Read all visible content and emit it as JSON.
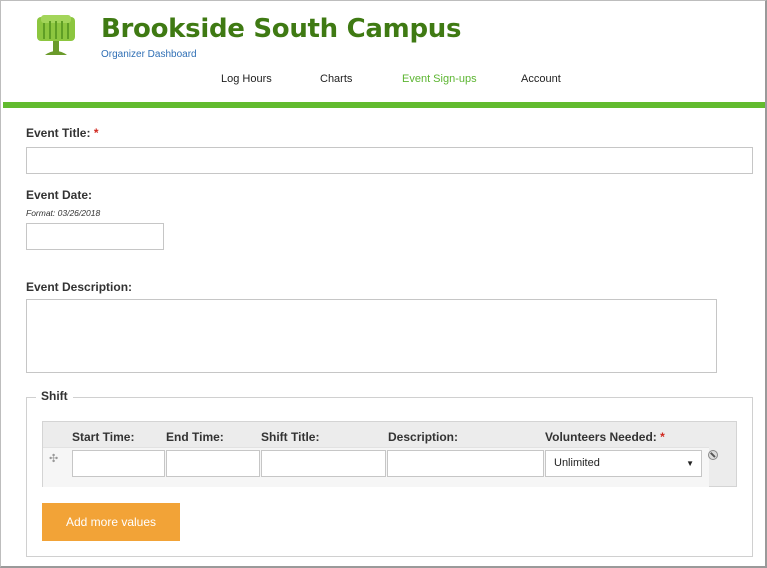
{
  "header": {
    "site_title": "Brookside South Campus",
    "slogan": "Organizer Dashboard",
    "logo_icon": "tree-logo-icon"
  },
  "nav": {
    "items": [
      {
        "label": "Log Hours"
      },
      {
        "label": "Charts"
      },
      {
        "label": "Event Sign-ups",
        "active": true
      },
      {
        "label": "Account"
      }
    ]
  },
  "colors": {
    "brand_green": "#3f7a13",
    "accent_bar": "#62bb2f",
    "button": "#f2a337",
    "required": "#d0281f"
  },
  "form": {
    "event_title": {
      "label": "Event Title:",
      "required_mark": "*",
      "value": ""
    },
    "event_date": {
      "label": "Event Date:",
      "hint": "Format: 03/26/2018",
      "value": ""
    },
    "event_description": {
      "label": "Event Description:",
      "value": ""
    },
    "shift": {
      "legend": "Shift",
      "columns": {
        "start_time": "Start Time:",
        "end_time": "End Time:",
        "shift_title": "Shift Title:",
        "description": "Description:",
        "volunteers_needed": "Volunteers Needed:",
        "required_mark": "*"
      },
      "row": {
        "start_time": "",
        "end_time": "",
        "shift_title": "",
        "description": "",
        "volunteers_needed": "Unlimited"
      },
      "add_more_label": "Add more values"
    }
  }
}
